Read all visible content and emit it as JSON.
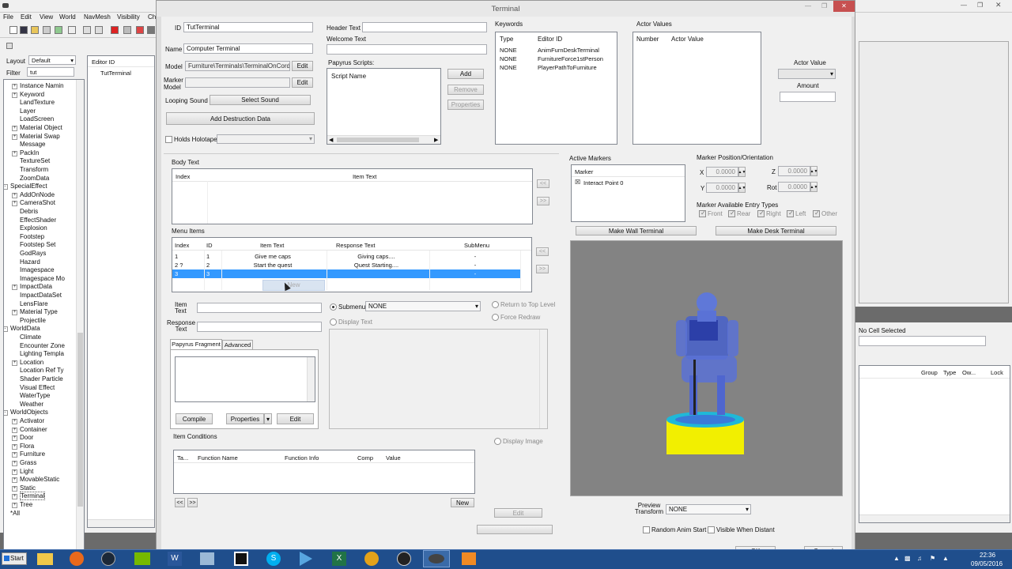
{
  "editor_menu": [
    "File",
    "Edit",
    "View",
    "World",
    "NavMesh",
    "Visibility",
    "Ch"
  ],
  "left_panel": {
    "layout_label": "Layout",
    "layout_value": "Default",
    "filter_label": "Filter",
    "filter_value": "tut",
    "editor_id_header": "Editor ID",
    "result": "TutTerminal",
    "tree": [
      {
        "label": "Instance Namin",
        "level": 1,
        "exp": "+"
      },
      {
        "label": "Keyword",
        "level": 1,
        "exp": "+"
      },
      {
        "label": "LandTexture",
        "level": 1,
        "exp": ""
      },
      {
        "label": "Layer",
        "level": 1,
        "exp": ""
      },
      {
        "label": "LoadScreen",
        "level": 1,
        "exp": ""
      },
      {
        "label": "Material Object",
        "level": 1,
        "exp": "+"
      },
      {
        "label": "Material Swap",
        "level": 1,
        "exp": "+"
      },
      {
        "label": "Message",
        "level": 1,
        "exp": ""
      },
      {
        "label": "PackIn",
        "level": 1,
        "exp": "+"
      },
      {
        "label": "TextureSet",
        "level": 1,
        "exp": ""
      },
      {
        "label": "Transform",
        "level": 1,
        "exp": ""
      },
      {
        "label": "ZoomData",
        "level": 1,
        "exp": ""
      },
      {
        "label": "SpecialEffect",
        "level": 0,
        "exp": "-"
      },
      {
        "label": "AddOnNode",
        "level": 1,
        "exp": "+"
      },
      {
        "label": "CameraShot",
        "level": 1,
        "exp": "+"
      },
      {
        "label": "Debris",
        "level": 1,
        "exp": ""
      },
      {
        "label": "EffectShader",
        "level": 1,
        "exp": ""
      },
      {
        "label": "Explosion",
        "level": 1,
        "exp": ""
      },
      {
        "label": "Footstep",
        "level": 1,
        "exp": ""
      },
      {
        "label": "Footstep Set",
        "level": 1,
        "exp": ""
      },
      {
        "label": "GodRays",
        "level": 1,
        "exp": ""
      },
      {
        "label": "Hazard",
        "level": 1,
        "exp": ""
      },
      {
        "label": "Imagespace",
        "level": 1,
        "exp": ""
      },
      {
        "label": "Imagespace Mo",
        "level": 1,
        "exp": ""
      },
      {
        "label": "ImpactData",
        "level": 1,
        "exp": "+"
      },
      {
        "label": "ImpactDataSet",
        "level": 1,
        "exp": ""
      },
      {
        "label": "LensFlare",
        "level": 1,
        "exp": ""
      },
      {
        "label": "Material Type",
        "level": 1,
        "exp": "+"
      },
      {
        "label": "Projectile",
        "level": 1,
        "exp": ""
      },
      {
        "label": "WorldData",
        "level": 0,
        "exp": "-"
      },
      {
        "label": "Climate",
        "level": 1,
        "exp": ""
      },
      {
        "label": "Encounter Zone",
        "level": 1,
        "exp": ""
      },
      {
        "label": "Lighting Templa",
        "level": 1,
        "exp": ""
      },
      {
        "label": "Location",
        "level": 1,
        "exp": "+"
      },
      {
        "label": "Location Ref Ty",
        "level": 1,
        "exp": ""
      },
      {
        "label": "Shader Particle",
        "level": 1,
        "exp": ""
      },
      {
        "label": "Visual Effect",
        "level": 1,
        "exp": ""
      },
      {
        "label": "WaterType",
        "level": 1,
        "exp": ""
      },
      {
        "label": "Weather",
        "level": 1,
        "exp": ""
      },
      {
        "label": "WorldObjects",
        "level": 0,
        "exp": "-"
      },
      {
        "label": "Activator",
        "level": 1,
        "exp": "+"
      },
      {
        "label": "Container",
        "level": 1,
        "exp": "+"
      },
      {
        "label": "Door",
        "level": 1,
        "exp": "+"
      },
      {
        "label": "Flora",
        "level": 1,
        "exp": "+"
      },
      {
        "label": "Furniture",
        "level": 1,
        "exp": "+"
      },
      {
        "label": "Grass",
        "level": 1,
        "exp": "+"
      },
      {
        "label": "Light",
        "level": 1,
        "exp": "+"
      },
      {
        "label": "MovableStatic",
        "level": 1,
        "exp": "+"
      },
      {
        "label": "Static",
        "level": 1,
        "exp": "+"
      },
      {
        "label": "Terminal",
        "level": 1,
        "exp": "+"
      },
      {
        "label": "Tree",
        "level": 1,
        "exp": "+"
      },
      {
        "label": "*All",
        "level": 0,
        "exp": ""
      }
    ]
  },
  "dialog": {
    "title": "Terminal",
    "id_label": "ID",
    "id_value": "TutTerminal",
    "name_label": "Name",
    "name_value": "Computer Terminal",
    "model_label": "Model",
    "model_value": "Furniture\\Terminals\\TerminalOnCorded.n",
    "edit_label": "Edit",
    "marker_model_label": "Marker Model",
    "looping_sound_label": "Looping Sound",
    "select_sound_label": "Select Sound",
    "add_destruction_label": "Add Destruction Data",
    "holds_holotape_label": "Holds Holotape",
    "header_text_label": "Header Text",
    "welcome_text_label": "Welcome Text",
    "papyrus_scripts_label": "Papyrus Scripts:",
    "script_name_header": "Script Name",
    "add_label": "Add",
    "remove_label": "Remove",
    "properties_label": "Properties",
    "keywords_label": "Keywords",
    "keywords_headers": [
      "Type",
      "Editor ID"
    ],
    "keywords": [
      [
        "NONE",
        "AnimFurnDeskTerminal"
      ],
      [
        "NONE",
        "FurnitureForce1stPerson"
      ],
      [
        "NONE",
        "PlayerPathToFurniture"
      ]
    ],
    "actor_values_label": "Actor Values",
    "actor_values_headers": [
      "Number",
      "Actor Value"
    ],
    "actor_value_label": "Actor Value",
    "amount_label": "Amount",
    "body_text_label": "Body Text",
    "body_headers": [
      "Index",
      "Item Text"
    ],
    "arrow_left": "<<",
    "arrow_right": ">>",
    "menu_items_label": "Menu Items",
    "menu_headers": [
      "Index",
      "ID",
      "Item Text",
      "Response Text",
      "SubMenu"
    ],
    "menu_rows": [
      [
        "1",
        "1",
        "Give me caps",
        "Giving caps....",
        "-"
      ],
      [
        "2 ?",
        "2",
        "Start the quest",
        "Quest Starting....",
        "-"
      ],
      [
        "3",
        "3",
        "",
        "",
        "-"
      ]
    ],
    "new_label": "New",
    "item_text_label": "Item Text",
    "response_text_label": "Response Text",
    "submenu_label": "Submenu",
    "submenu_value": "NONE",
    "display_text_label": "Display Text",
    "return_top_label": "Return to Top Level",
    "force_redraw_label": "Force Redraw",
    "papyrus_fragment_tab": "Papyrus Fragment",
    "advanced_tab": "Advanced",
    "compile_label": "Compile",
    "item_conditions_label": "Item Conditions",
    "conditions_headers": [
      "Ta...",
      "Function Name",
      "Function Info",
      "Comp",
      "Value"
    ],
    "display_image_label": "Display Image",
    "active_markers_label": "Active Markers",
    "marker_header": "Marker",
    "marker_item": "Interact Point 0",
    "marker_pos_label": "Marker Position/Orientation",
    "x_label": "X",
    "y_label": "Y",
    "z_label": "Z",
    "rot_label": "Rot",
    "x_value": "0.0000",
    "y_value": "0.0000",
    "z_value": "0.0000",
    "rot_value": "0.0000",
    "entry_types_label": "Marker Available Entry Types",
    "entry_types": [
      "Front",
      "Rear",
      "Right",
      "Left",
      "Other"
    ],
    "make_wall_label": "Make Wall Terminal",
    "make_desk_label": "Make Desk Terminal",
    "preview_transform_label": "Preview Transform",
    "preview_transform_value": "NONE",
    "random_anim_label": "Random Anim Start",
    "visible_distant_label": "Visible When Distant",
    "ok_label": "OK",
    "cancel_label": "Cancel"
  },
  "right_panel": {
    "no_cell": "No Cell Selected",
    "headers": [
      "Group",
      "Type",
      "Ow...",
      "Lock"
    ]
  },
  "taskbar": {
    "start": "Start",
    "time": "22:36",
    "date": "09/05/2016"
  }
}
